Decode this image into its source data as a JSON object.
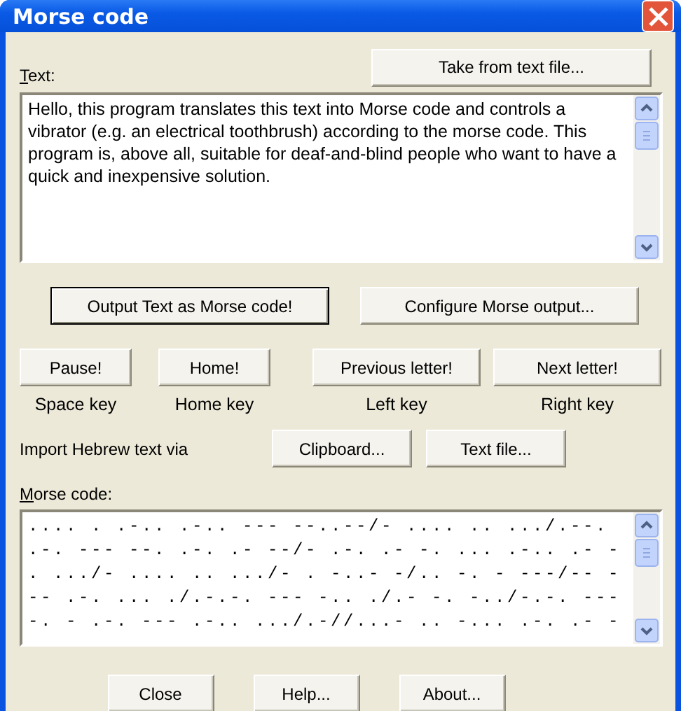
{
  "window": {
    "title": "Morse code"
  },
  "text_section": {
    "label": "Text:",
    "button": "Take from text file...",
    "value": "Hello, this program translates this text into Morse code and controls a vibrator (e.g. an electrical toothbrush) according to the morse code. This program is, above all, suitable for deaf-and-blind people who want to have a quick and inexpensive solution."
  },
  "main_buttons": [
    {
      "label": "Output Text as Morse code!",
      "default": true
    },
    {
      "label": "Configure Morse output...",
      "default": false
    }
  ],
  "nav_buttons": [
    {
      "label": "Pause!",
      "key": "Space key"
    },
    {
      "label": "Home!",
      "key": "Home key"
    },
    {
      "label": "Previous letter!",
      "key": "Left key"
    },
    {
      "label": "Next letter!",
      "key": "Right key"
    }
  ],
  "import": {
    "label": "Import Hebrew text via",
    "buttons": [
      "Clipboard...",
      "Text file..."
    ]
  },
  "morse_section": {
    "label": "Morse code:",
    "lines": [
      ".... . .-.. .-.. --- --..--/- .... .. .../.--.",
      ".-. --- --. .-. .- --/- .-. .- -. ... .-.. .- -",
      ". .../- .... .. .../- . -..- -/.. -. - ---/-- -",
      "-- .-. ... ./.-.-. --- -.. ./.- -. -../-.-. ---",
      "-. - .-. --- .-.. .../.-//...- .. -... .-. .- -"
    ]
  },
  "footer_buttons": [
    "Close",
    "Help...",
    "About..."
  ]
}
